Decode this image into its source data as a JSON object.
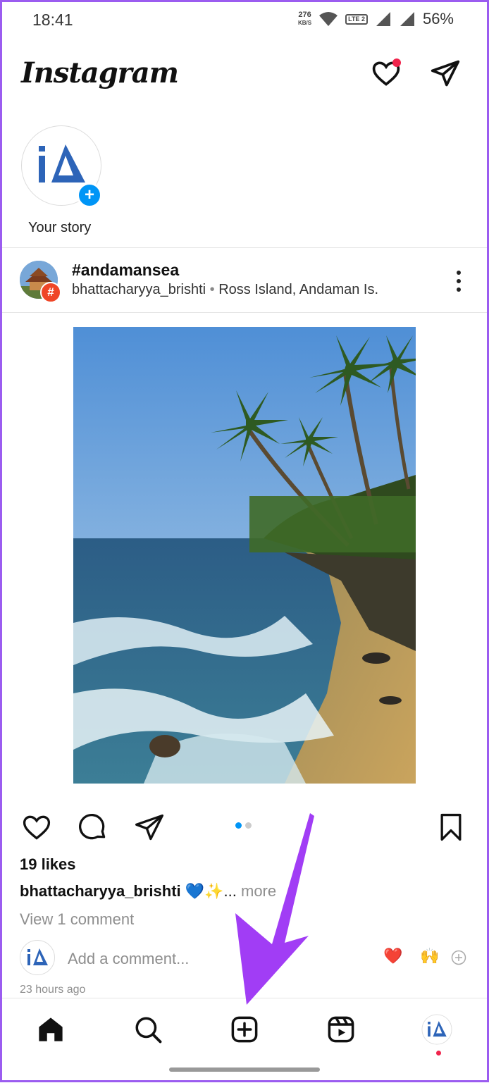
{
  "status_bar": {
    "time": "18:41",
    "data_rate_value": "276",
    "data_rate_unit": "KB/S",
    "lte_label": "LTE 2",
    "battery": "56%"
  },
  "header": {
    "logo": "Instagram",
    "notification_dot_color": "#f0244c"
  },
  "stories": [
    {
      "label": "Your story",
      "avatar_text": "iΔ"
    }
  ],
  "post": {
    "title": "#andamansea",
    "username": "bhattacharyya_brishti",
    "separator": " • ",
    "location": "Ross Island, Andaman Is.",
    "badge": "#",
    "carousel_index": 1,
    "carousel_count": 2,
    "likes": "19 likes",
    "caption_user": "bhattacharyya_brishti",
    "caption_text": " 💙✨... ",
    "caption_more": "more",
    "view_comments": "View 1 comment",
    "comment_placeholder": "Add a comment...",
    "quick_reactions": [
      "❤️",
      "🙌"
    ],
    "time_ago": "23 hours ago"
  },
  "nav": {
    "items": [
      "home",
      "search",
      "create",
      "reels",
      "profile"
    ],
    "active": "home"
  },
  "colors": {
    "accent_blue": "#0095f6",
    "annotation_purple": "#a13df5"
  }
}
